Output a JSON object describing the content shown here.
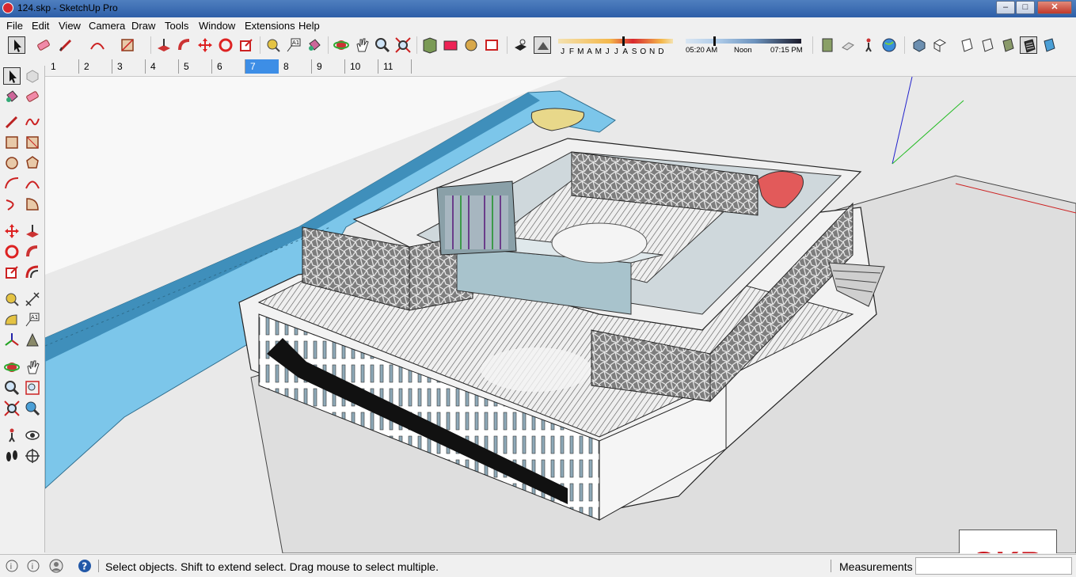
{
  "window": {
    "title": "124.skp - SketchUp Pro",
    "minimize_label": "–",
    "maximize_label": "□",
    "close_label": "✕"
  },
  "menu": [
    "File",
    "Edit",
    "View",
    "Camera",
    "Draw",
    "Tools",
    "Window",
    "Extensions",
    "Help"
  ],
  "shadow": {
    "months": [
      "J",
      "F",
      "M",
      "A",
      "M",
      "J",
      "J",
      "A",
      "S",
      "O",
      "N",
      "D"
    ],
    "time_start": "05:20 AM",
    "time_mid": "Noon",
    "time_end": "07:15 PM"
  },
  "scenes": {
    "tabs": [
      "1",
      "2",
      "3",
      "4",
      "5",
      "6",
      "7",
      "8",
      "9",
      "10",
      "11"
    ],
    "active": "7"
  },
  "badge": {
    "text": "SKP"
  },
  "status": {
    "message": "Select objects. Shift to extend select. Drag mouse to select multiple.",
    "measurements_label": "Measurements",
    "measurements_value": ""
  },
  "colors": {
    "accent": "#3d8ee6",
    "badge_red": "#c8161d",
    "water": "#6ec3e8"
  }
}
